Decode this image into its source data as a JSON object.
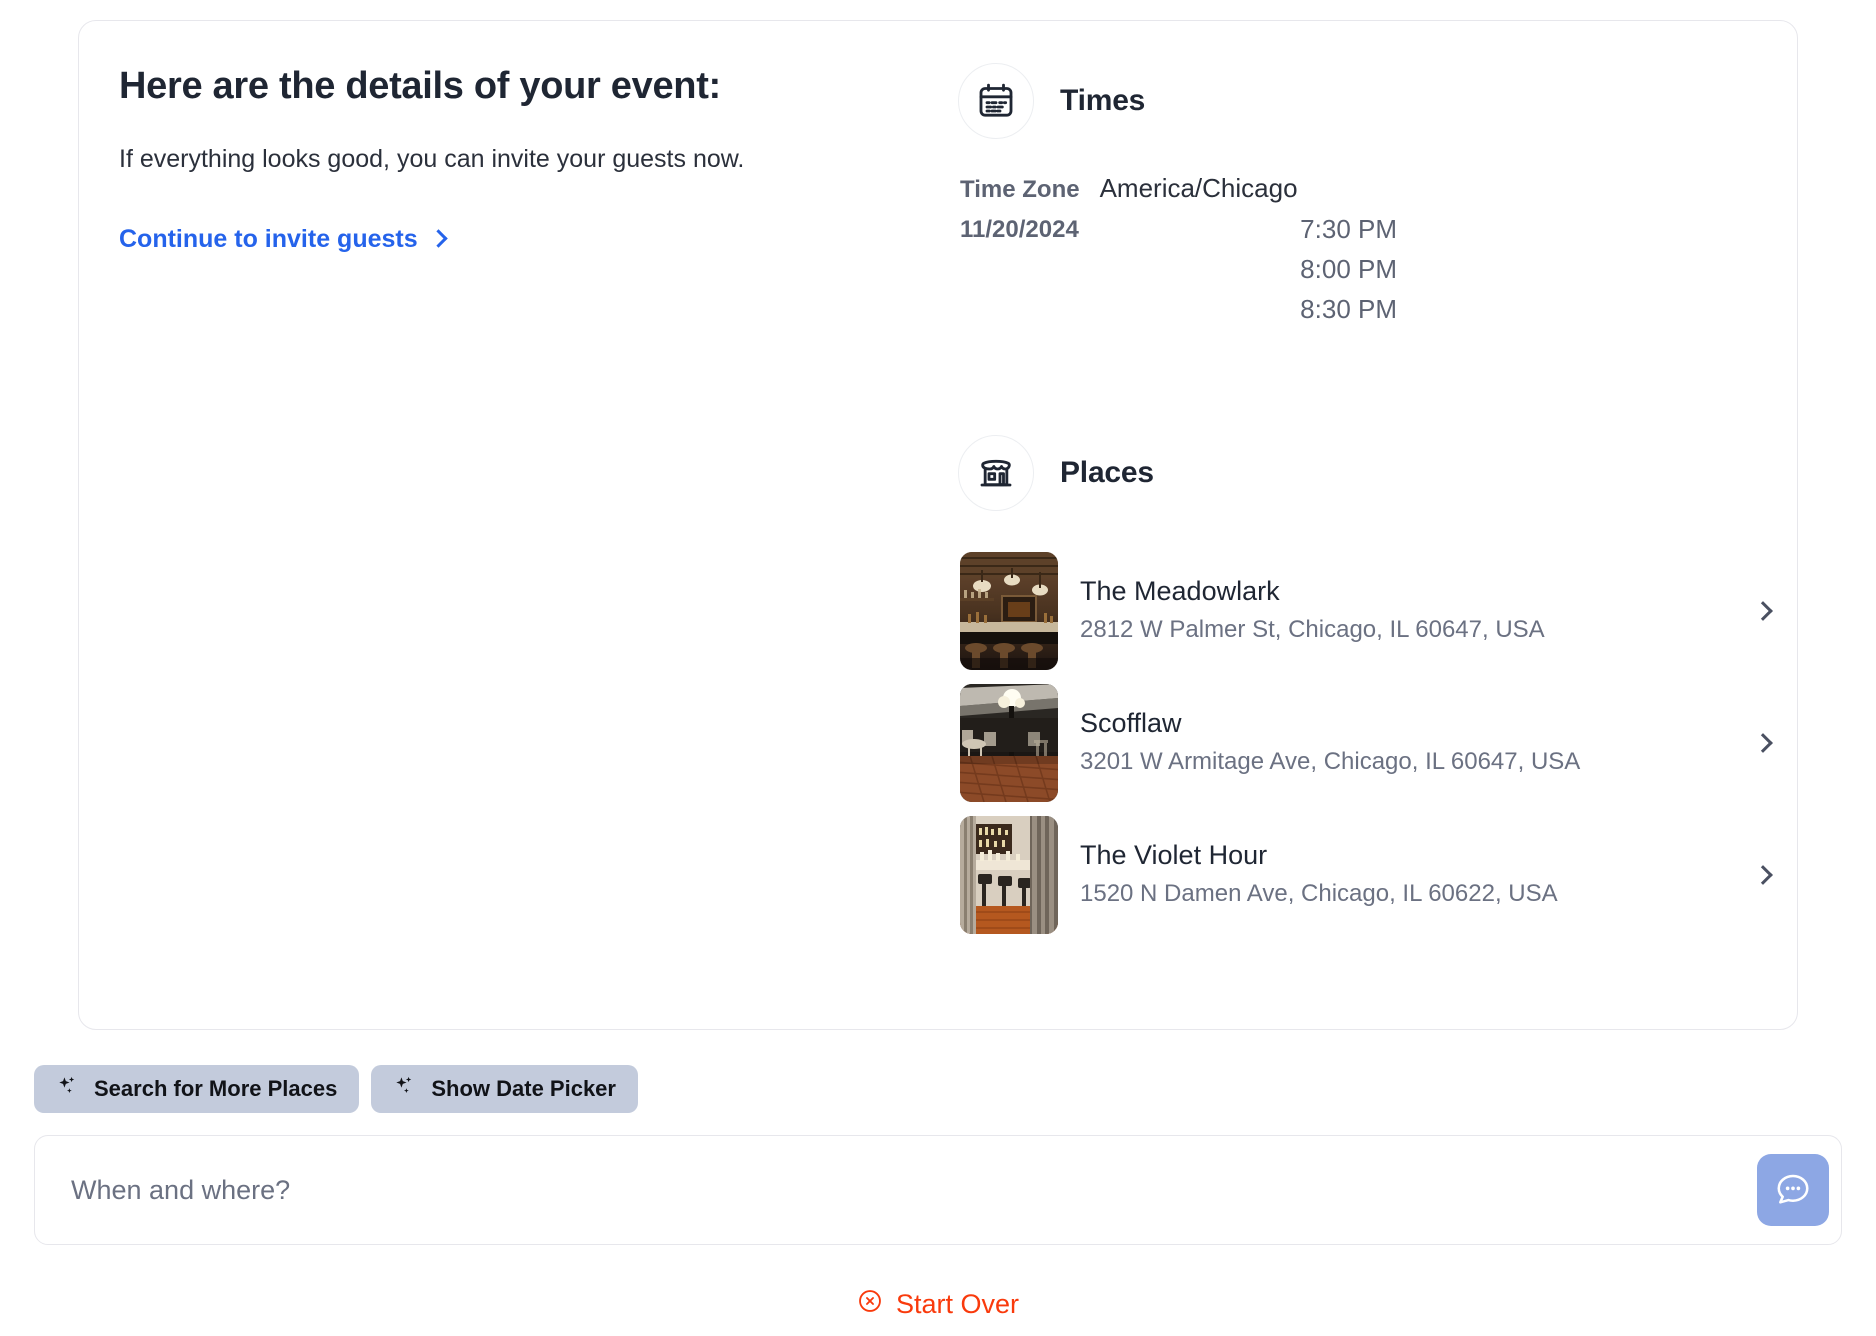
{
  "card": {
    "headline": "Here are the details of your event:",
    "subtext": "If everything looks good, you can invite your guests now.",
    "invite_link_label": "Continue to invite guests",
    "chevron_icon": "chevron-right-icon"
  },
  "times": {
    "icon": "calendar-icon",
    "title": "Times",
    "timezone_label": "Time Zone",
    "timezone_value": "America/Chicago",
    "date_label": "11/20/2024",
    "slots": [
      "7:30 PM",
      "8:00 PM",
      "8:30 PM"
    ]
  },
  "places": {
    "icon": "storefront-icon",
    "title": "Places",
    "items": [
      {
        "name": "The Meadowlark",
        "address": "2812 W Palmer St, Chicago, IL 60647, USA",
        "thumbnail": "bar-interior-wood-pendant-lights",
        "chevron_icon": "chevron-right-icon"
      },
      {
        "name": "Scofflaw",
        "address": "3201 W Armitage Ave, Chicago, IL 60647, USA",
        "thumbnail": "patio-brick-lamppost-chairs",
        "chevron_icon": "chevron-right-icon"
      },
      {
        "name": "The Violet Hour",
        "address": "1520 N Damen Ave, Chicago, IL 60622, USA",
        "thumbnail": "bar-curtains-warm-floor",
        "chevron_icon": "chevron-right-icon"
      }
    ]
  },
  "suggestions": [
    {
      "label": "Search for More Places",
      "icon": "sparkles-icon"
    },
    {
      "label": "Show Date Picker",
      "icon": "sparkles-icon"
    }
  ],
  "composer": {
    "placeholder": "When and where?",
    "value": "",
    "send_icon": "chat-bubble-icon"
  },
  "footer": {
    "start_over_label": "Start Over",
    "start_over_icon": "circle-x-icon"
  },
  "colors": {
    "accent_blue": "#2563eb",
    "send_button": "#8da7e4",
    "pill_bg": "#c3cbdc",
    "danger": "#f93a0c",
    "text_dark": "#1f2633",
    "text_muted": "#6b7182"
  }
}
